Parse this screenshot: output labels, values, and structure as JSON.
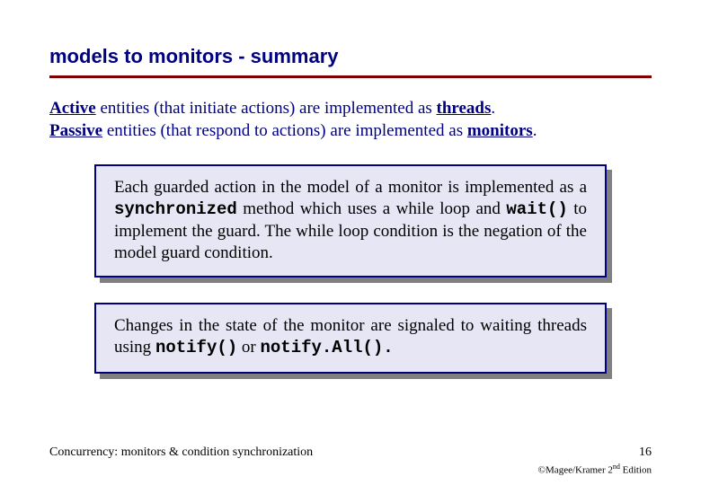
{
  "title": "models to monitors - summary",
  "intro": {
    "active_bold": "Active",
    "active_rest": " entities (that initiate actions) are implemented as ",
    "active_end": "threads",
    "period1": ".",
    "passive_bold": "Passive",
    "passive_rest": " entities (that respond to actions) are implemented as ",
    "passive_end": "monitors",
    "period2": "."
  },
  "box1": {
    "seg1": "Each guarded action in the model of a monitor is implemented as a ",
    "code1": "synchronized",
    "seg2": " method which uses a while loop and ",
    "code2": "wait()",
    "seg3": " to implement the guard. The while loop condition is the negation of the model guard condition."
  },
  "box2": {
    "seg1": "Changes in the state of the monitor are signaled to waiting threads using ",
    "code1": "notify()",
    "seg2": " or ",
    "code2": "notify.All().",
    "seg3": ""
  },
  "footer": {
    "left": "Concurrency: monitors & condition synchronization",
    "right": "16",
    "copyright_pre": "©Magee/Kramer ",
    "copyright_ed_num": "2",
    "copyright_ed_sup": "nd",
    "copyright_post": " Edition"
  }
}
